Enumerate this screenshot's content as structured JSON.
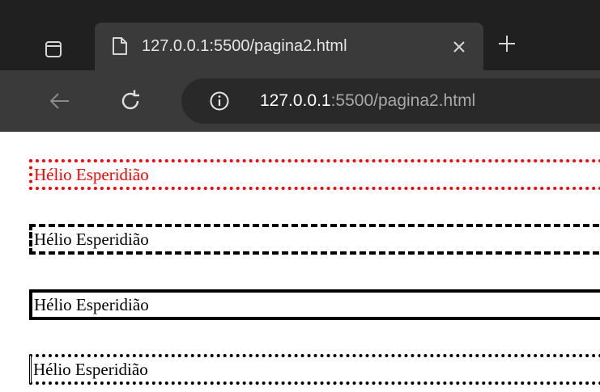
{
  "browser": {
    "tab": {
      "title": "127.0.0.1:5500/pagina2.html"
    },
    "address_bar": {
      "url_host": "127.0.0.1",
      "url_rest": ":5500/pagina2.html"
    },
    "icons": {
      "tab_actions": "tab-actions-icon",
      "favicon": "page-icon",
      "close": "close-icon",
      "new_tab": "plus-icon",
      "back": "back-arrow-icon",
      "reload": "reload-icon",
      "site_info": "info-icon"
    },
    "colors": {
      "tabbar_bg": "#202020",
      "active_tab_bg": "#3a3a3a",
      "address_bg": "#292929"
    }
  },
  "page": {
    "boxes": [
      {
        "text": "Hélio Esperidião",
        "border_style": "dotted",
        "color": "#ff0000"
      },
      {
        "text": "Hélio Esperidião",
        "border_style": "dashed",
        "color": "#000000"
      },
      {
        "text": "Hélio Esperidião",
        "border_style": "solid",
        "color": "#000000"
      },
      {
        "text": "Hélio Esperidião",
        "border_style": "dotted",
        "color": "#000000"
      }
    ]
  }
}
